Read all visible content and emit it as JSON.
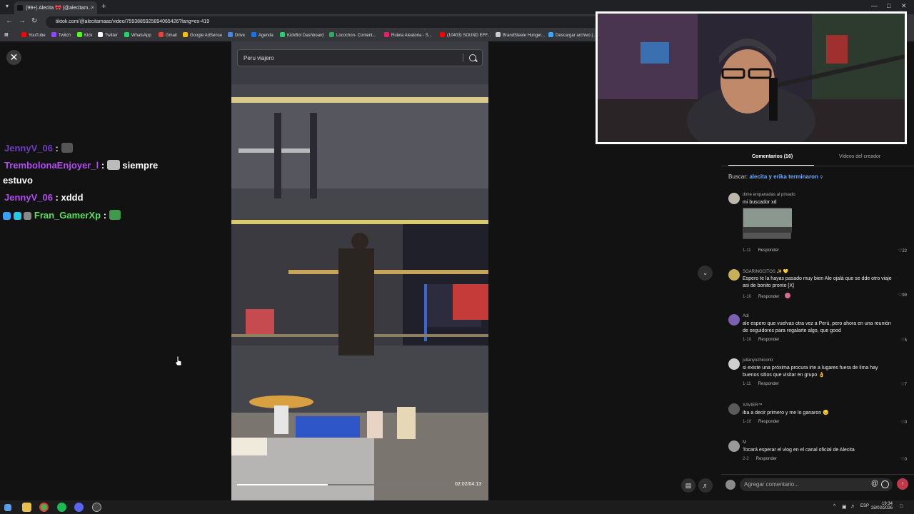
{
  "browser": {
    "tab_title": "(99+) Alecita 🎀 (@alecitam...",
    "tab_close": "×",
    "new_tab": "+",
    "url": "tiktok.com/@alecitamaac/video/7593885925894065426?lang=es-419",
    "bookmarks": [
      "YouTube",
      "Twitch",
      "Kick",
      "Twitter",
      "WhatsApp",
      "Gmail",
      "Google AdSense",
      "Drive",
      "Agenda",
      "KickBot Dashboard",
      "Locochon- Content...",
      "Ruleta Aleatoria - S...",
      "(10403) SOUND EFF...",
      "BrandSteele Hunger...",
      "Descargar archivo |..."
    ],
    "bookmark_colors": [
      "#ff0000",
      "#9146ff",
      "#53fc18",
      "#ffffff",
      "#25d366",
      "#ea4335",
      "#fbbc04",
      "#4285f4",
      "#1a73e8",
      "#2ecc71",
      "#27ae60",
      "#e91e63",
      "#ff0000",
      "#cccccc",
      "#3ea6ff"
    ]
  },
  "chat": [
    {
      "user": "JennyV_06",
      "sep": " :",
      "text": "",
      "user_color": "#6e3ec0"
    },
    {
      "user": "TrembolonaEnjoyer_l",
      "sep": " :",
      "text": "siempre",
      "text2": "estuvo",
      "user_color": "#b04cf0"
    },
    {
      "user": "JennyV_06",
      "sep": " : xddd",
      "text": "",
      "user_color": "#b04cf0"
    },
    {
      "user": "Fran_GamerXp",
      "sep": " :",
      "text": "",
      "user_color": "#55e05a"
    }
  ],
  "video": {
    "search_text": "Peru viajero",
    "progress": 0.43,
    "time": "02:02/04:13"
  },
  "panel": {
    "tab_comments": "Comentarios (16)",
    "tab_creator": "Videos del creador",
    "buscar_label": "Buscar:",
    "buscar_query": "alecita y erika terminaron",
    "comments": [
      {
        "name": "dime empanadas al privado",
        "text": "mi buscador xd",
        "date": "1-11",
        "reply": "Responder",
        "likes": "22"
      },
      {
        "name": "SOARINGCITOS ✨ 💛",
        "text": "Espero te la hayas pasado muy bien Ale ojalá que se dde otro viaje asi de bonito pronto [X]",
        "date": "1-10",
        "reply": "Responder",
        "likes": "99"
      },
      {
        "name": "Adi",
        "text": "ale espero que vuelvas otra vez a Perú, pero ahora en una reunión de seguidores para regalarte algo, que good",
        "date": "1-10",
        "reply": "Responder",
        "likes": "5"
      },
      {
        "name": "julianyozhiicontr",
        "text": "si existe una próxima procura irte a lugares fuera de lima hay buenos sitios que visitar en grupo 👌",
        "date": "1-11",
        "reply": "Responder",
        "likes": "7"
      },
      {
        "name": "XAVIER™",
        "text": "iba a decir primero y me lo ganaron 😔",
        "date": "1-10",
        "reply": "Responder",
        "likes": "0"
      },
      {
        "name": "M",
        "text": "Tocará esperar el vlog en el canal oficial de Alecita",
        "date": "2-2",
        "reply": "Responder",
        "likes": "0"
      }
    ],
    "comment_placeholder": "Agregar comentario...",
    "at_symbol": "@"
  },
  "taskbar": {
    "lang": "ESP",
    "time": "19:34",
    "date": "28/03/2026"
  }
}
